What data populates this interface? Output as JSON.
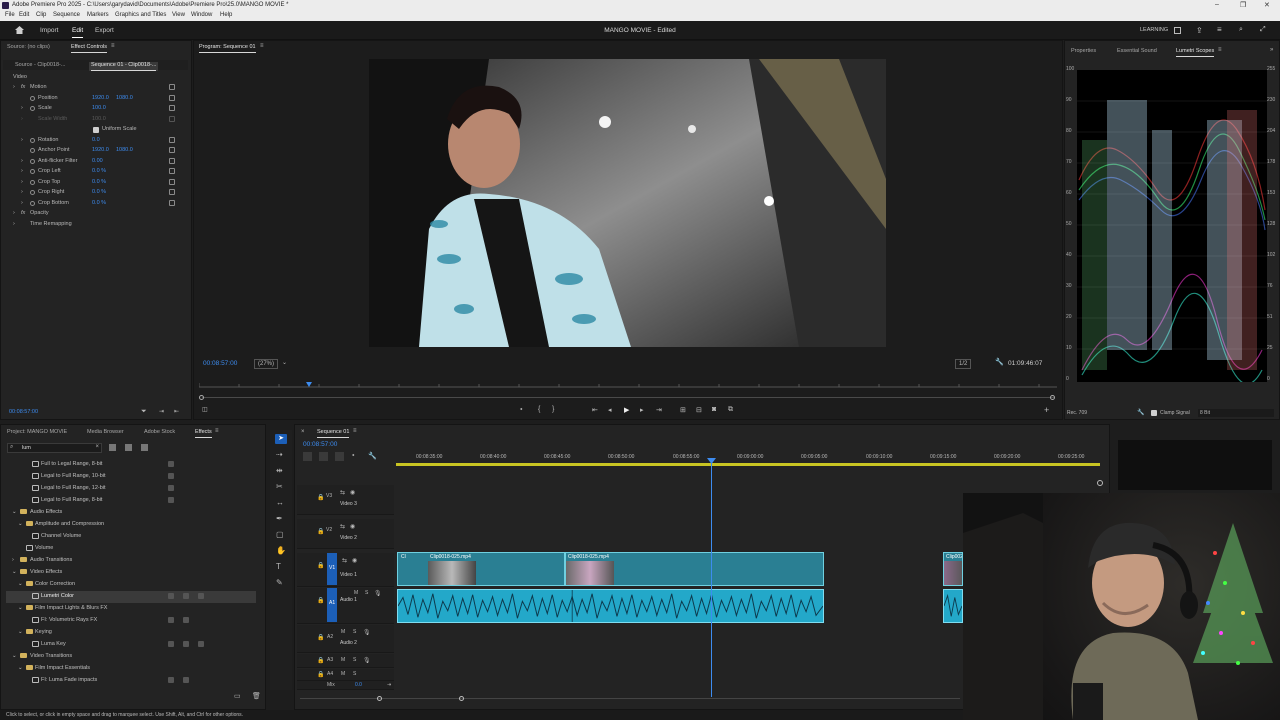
{
  "window": {
    "title": "Adobe Premiere Pro 2025 - C:\\Users\\garydavid\\Documents\\Adobe\\Premiere Pro\\25.0\\MANGO MOVIE *",
    "menu": [
      "File",
      "Edit",
      "Clip",
      "Sequence",
      "Markers",
      "Graphics and Titles",
      "View",
      "Window",
      "Help"
    ]
  },
  "header": {
    "tabs": [
      "Import",
      "Edit",
      "Export"
    ],
    "active_tab": "Edit",
    "project_title": "MANGO MOVIE - Edited",
    "learning": "LEARNING"
  },
  "source_panel": {
    "tabs": [
      "Source: (no clips)",
      "Effect Controls"
    ],
    "subtabs": [
      "Source - Clip0018-...",
      "Sequence 01 - Clip0018-..."
    ],
    "section": "Video",
    "rows": [
      {
        "label": "Motion",
        "value": "",
        "value2": ""
      },
      {
        "label": "Position",
        "value": "1920.0",
        "value2": "1080.0"
      },
      {
        "label": "Scale",
        "value": "100.0",
        "value2": ""
      },
      {
        "label": "Scale Width",
        "value": "100.0",
        "value2": ""
      },
      {
        "label": "Uniform Scale",
        "value": "",
        "value2": ""
      },
      {
        "label": "Rotation",
        "value": "0.0",
        "value2": ""
      },
      {
        "label": "Anchor Point",
        "value": "1920.0",
        "value2": "1080.0"
      },
      {
        "label": "Anti-flicker Filter",
        "value": "0.00",
        "value2": ""
      },
      {
        "label": "Crop Left",
        "value": "0.0 %",
        "value2": ""
      },
      {
        "label": "Crop Top",
        "value": "0.0 %",
        "value2": ""
      },
      {
        "label": "Crop Right",
        "value": "0.0 %",
        "value2": ""
      },
      {
        "label": "Crop Bottom",
        "value": "0.0 %",
        "value2": ""
      },
      {
        "label": "Opacity",
        "value": "",
        "value2": ""
      },
      {
        "label": "Time Remapping",
        "value": "",
        "value2": ""
      }
    ],
    "timecode": "00:08:57:00"
  },
  "program": {
    "tab": "Program: Sequence 01",
    "timecode": "00:08:57:00",
    "zoom": "(27%)",
    "quality": "1/2",
    "duration": "01:09:46:07"
  },
  "right_panel": {
    "tabs": [
      "Properties",
      "Essential Sound",
      "Lumetri Scopes"
    ],
    "active_tab": "Lumetri Scopes",
    "left_scale": [
      "100",
      "90",
      "80",
      "70",
      "60",
      "50",
      "40",
      "30",
      "20",
      "10",
      "0"
    ],
    "right_scale": [
      "255",
      "230",
      "204",
      "178",
      "153",
      "128",
      "102",
      "76",
      "51",
      "25",
      "0"
    ],
    "footer_left": "Rec. 709",
    "clamp_label": "Clamp Signal",
    "bit_depth": "8 Bit"
  },
  "project_panel": {
    "tabs": [
      "Project: MANGO MOVIE",
      "Media Browser",
      "Adobe Stock",
      "Effects"
    ],
    "active_tab": "Effects",
    "search_value": "lum",
    "items": [
      {
        "label": "Full to Legal Range, 8-bit",
        "indent": 2,
        "kind": "preset"
      },
      {
        "label": "Legal to Full Range, 10-bit",
        "indent": 2,
        "kind": "preset"
      },
      {
        "label": "Legal to Full Range, 12-bit",
        "indent": 2,
        "kind": "preset"
      },
      {
        "label": "Legal to Full Range, 8-bit",
        "indent": 2,
        "kind": "preset"
      },
      {
        "label": "Audio Effects",
        "indent": 0,
        "kind": "folder"
      },
      {
        "label": "Amplitude and Compression",
        "indent": 1,
        "kind": "folder"
      },
      {
        "label": "Channel Volume",
        "indent": 2,
        "kind": "effect"
      },
      {
        "label": "Volume",
        "indent": 1,
        "kind": "effect"
      },
      {
        "label": "Audio Transitions",
        "indent": 0,
        "kind": "folder"
      },
      {
        "label": "Video Effects",
        "indent": 0,
        "kind": "folder"
      },
      {
        "label": "Color Correction",
        "indent": 1,
        "kind": "folder"
      },
      {
        "label": "Lumetri Color",
        "indent": 2,
        "kind": "effect",
        "selected": true
      },
      {
        "label": "Film Impact Lights & Blurs FX",
        "indent": 1,
        "kind": "folder"
      },
      {
        "label": "FI: Volumetric Rays FX",
        "indent": 2,
        "kind": "effect"
      },
      {
        "label": "Keying",
        "indent": 1,
        "kind": "folder"
      },
      {
        "label": "Luma Key",
        "indent": 2,
        "kind": "effect"
      },
      {
        "label": "Video Transitions",
        "indent": 0,
        "kind": "folder"
      },
      {
        "label": "Film Impact Essentials",
        "indent": 1,
        "kind": "folder"
      },
      {
        "label": "FI: Luma Fade impacts",
        "indent": 2,
        "kind": "effect"
      }
    ]
  },
  "timeline": {
    "tab": "Sequence 01",
    "timecode": "00:08:57:00",
    "ruler": [
      "00:08:35:00",
      "00:08:40:00",
      "00:08:45:00",
      "00:08:50:00",
      "00:08:55:00",
      "00:09:00:00",
      "00:09:05:00",
      "00:09:10:00",
      "00:09:15:00",
      "00:09:20:00",
      "00:09:25:00"
    ],
    "tracks": [
      {
        "id": "V3",
        "name": "Video 3"
      },
      {
        "id": "V2",
        "name": "Video 2"
      },
      {
        "id": "V1",
        "name": "Video 1"
      },
      {
        "id": "A1",
        "name": "Audio 1"
      },
      {
        "id": "A2",
        "name": "Audio 2"
      },
      {
        "id": "A3",
        "name": ""
      },
      {
        "id": "A4",
        "name": ""
      },
      {
        "id": "Mix",
        "name": "0.0"
      }
    ],
    "clips": [
      {
        "name": "Cl",
        "kind": "video"
      },
      {
        "name": "Clip0018-025.mp4",
        "kind": "video"
      },
      {
        "name": "Clip0018-025.mp4",
        "kind": "video"
      },
      {
        "name": "Clip002",
        "kind": "video"
      }
    ]
  },
  "status": "Click to select, or click in empty space and drag to marquee select. Use Shift, Alt, and Ctrl for other options.",
  "colors": {
    "accent": "#3d8cf0",
    "clip_video": "#2a7f93",
    "clip_audio": "#23a8c9",
    "track_target": "#1c5fb8"
  }
}
